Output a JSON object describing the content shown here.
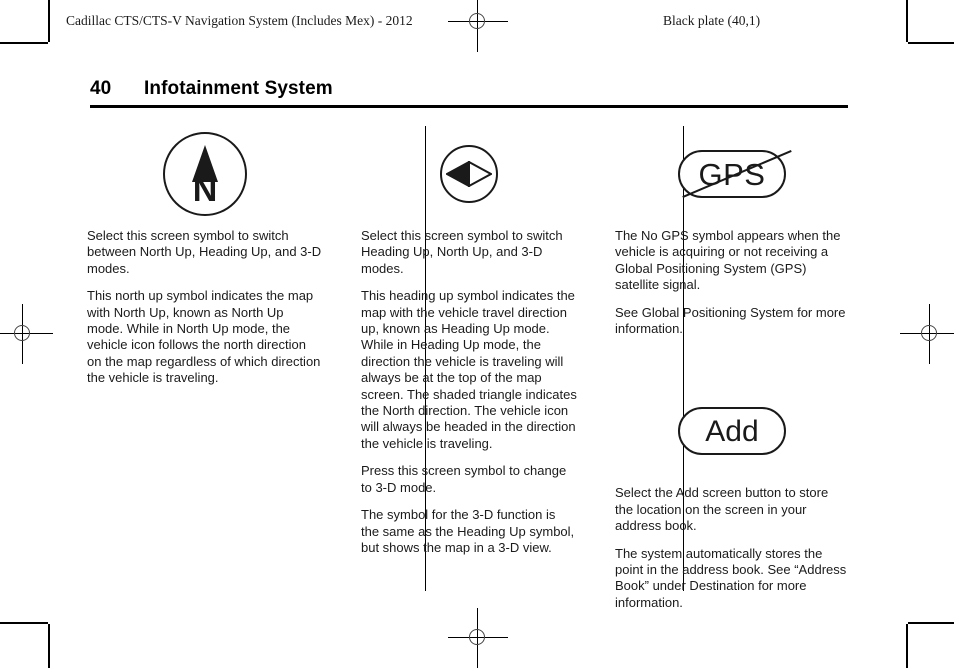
{
  "header": {
    "left_running_head": "Cadillac CTS/CTS-V Navigation System (Includes Mex) - 2012",
    "right_running_head": "Black plate (40,1)"
  },
  "page": {
    "folio": "40",
    "title": "Infotainment System"
  },
  "columns": [
    {
      "figure": {
        "name": "north-up-symbol",
        "type": "circle-arrow-letter",
        "letter": "N"
      },
      "paragraphs": [
        "Select this screen symbol to switch between North Up, Heading Up, and 3-D modes.",
        "This north up symbol indicates the map with North Up, known as North Up mode. While in North Up mode, the vehicle icon follows the north direction on the map regardless of which direction the vehicle is traveling."
      ]
    },
    {
      "figure": {
        "name": "heading-up-symbol",
        "type": "circle-diamond"
      },
      "paragraphs": [
        "Select this screen symbol to switch Heading Up, North Up, and 3-D modes.",
        "This heading up symbol indicates the map with the vehicle travel direction up, known as Heading Up mode. While in Heading Up mode, the direction the vehicle is traveling will always be at the top of the map screen. The shaded triangle indicates the North direction. The vehicle icon will always be headed in the direction the vehicle is traveling.",
        "Press this screen symbol to change to 3-D mode.",
        "The symbol for the 3-D function is the same as the Heading Up symbol, but shows the map in a 3-D view."
      ]
    },
    {
      "figure": {
        "name": "no-gps-symbol",
        "type": "pill-struck-through",
        "label": "GPS"
      },
      "paragraphs": [
        "The No GPS symbol appears when the vehicle is acquiring or not receiving a Global Positioning System (GPS) satellite signal.",
        "See Global Positioning System for more information."
      ],
      "figure2": {
        "name": "add-screen-button",
        "type": "pill-button",
        "label": "Add"
      },
      "paragraphs2": [
        "Select the Add screen button to store the location on the screen in your address book.",
        "The system automatically stores the point in the address book. See “Address Book” under Destination for more information."
      ]
    }
  ]
}
